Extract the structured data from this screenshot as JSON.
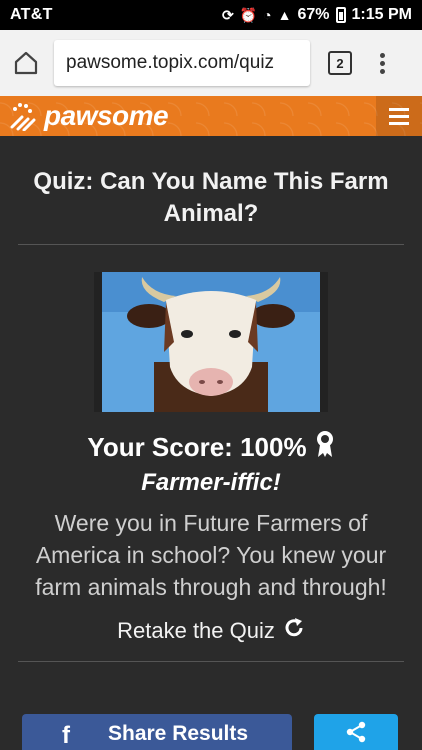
{
  "status_bar": {
    "carrier": "AT&T",
    "battery": "67%",
    "time": "1:15 PM"
  },
  "browser": {
    "url": "pawsome.topix.com/quiz",
    "tab_count": "2"
  },
  "site": {
    "logo_text": "pawsome"
  },
  "quiz": {
    "title": "Quiz: Can You Name This Farm Animal?",
    "score": "Your Score: 100%",
    "rating": "Farmer-iffic!",
    "description": "Were you in Future Farmers of America in school? You knew your farm animals through and through!",
    "retake_label": "Retake the Quiz"
  },
  "share": {
    "facebook_label": "Share Results"
  },
  "colors": {
    "header_orange": "#e97a1e",
    "facebook_blue": "#3b5998",
    "share_blue": "#1fa3e8",
    "background": "#2b2b2b"
  },
  "icons": {
    "home": "home-icon",
    "tabs": "tabs-icon",
    "menu": "more-vert-icon",
    "hamburger": "hamburger-icon",
    "ribbon": "ribbon-icon",
    "retake": "refresh-icon",
    "facebook": "facebook-icon",
    "share": "share-icon"
  }
}
